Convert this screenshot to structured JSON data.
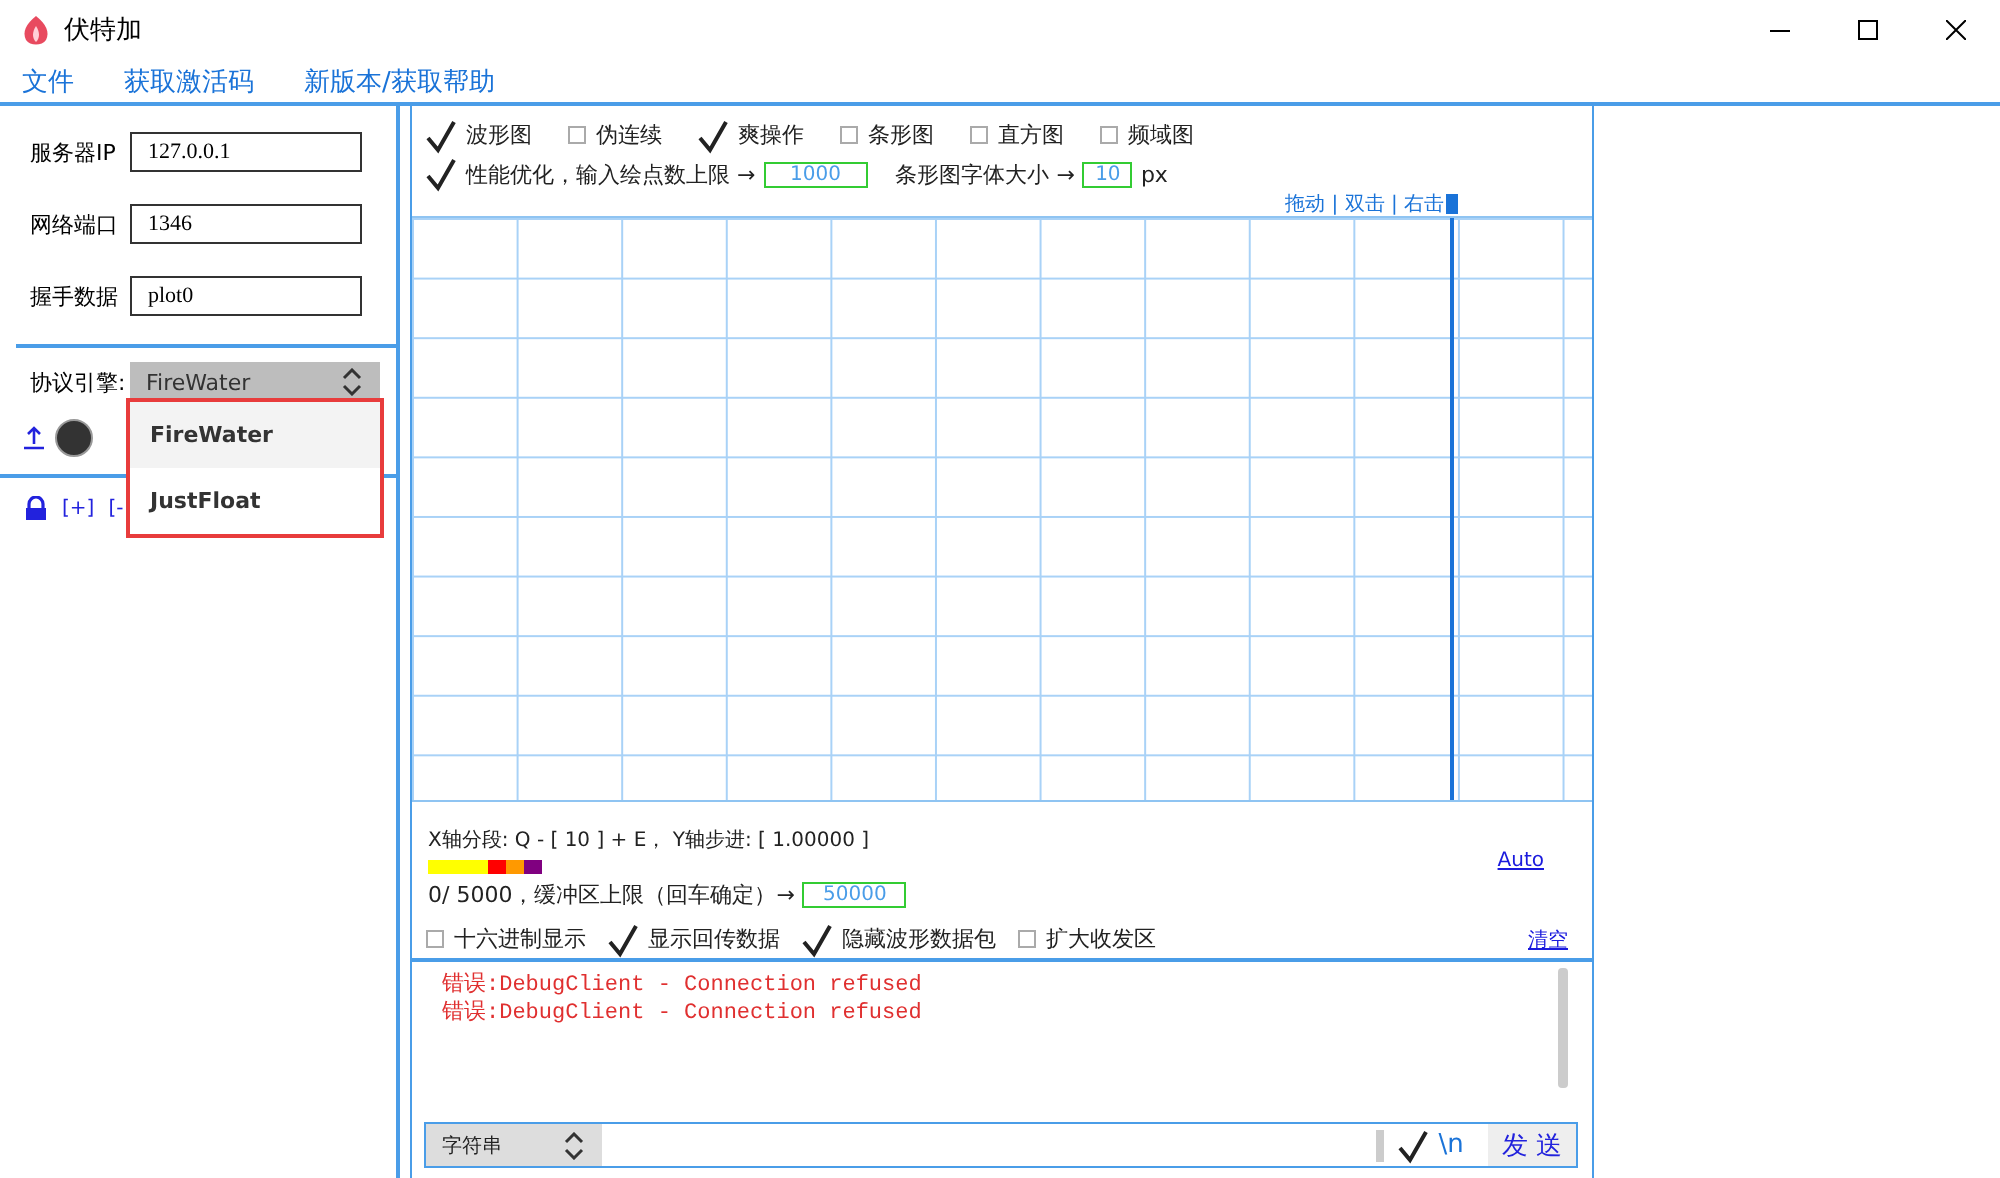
{
  "window": {
    "title": "伏特加"
  },
  "menu": [
    {
      "label": "文件"
    },
    {
      "label": "获取激活码"
    },
    {
      "label": "新版本/获取帮助"
    }
  ],
  "connection": {
    "fields": [
      {
        "label": "服务器IP",
        "value": "127.0.0.1"
      },
      {
        "label": "网络端口",
        "value": "1346"
      },
      {
        "label": "握手数据",
        "value": "plot0"
      }
    ],
    "protocol": {
      "label": "协议引擎:",
      "value": "FireWater",
      "options": [
        {
          "label": "FireWater",
          "selected": true
        },
        {
          "label": "JustFloat",
          "selected": false
        }
      ]
    },
    "toolbar": [
      "[+]",
      "[-"
    ]
  },
  "plot": {
    "options": [
      {
        "label": "波形图",
        "checked": true
      },
      {
        "label": "伪连续",
        "checked": false
      },
      {
        "label": "爽操作",
        "checked": true
      },
      {
        "label": "条形图",
        "checked": false
      },
      {
        "label": "直方图",
        "checked": false
      },
      {
        "label": "频域图",
        "checked": false
      }
    ],
    "perf": {
      "label": "性能优化，输入绘点数上限 →",
      "checked": true,
      "value": "1000"
    },
    "bar_font": {
      "label": "条形图字体大小 →",
      "value": "10",
      "unit": "px"
    },
    "hint": "拖动 | 双击 | 右击",
    "axis_info": "X轴分段: Q - [ 10 ] + E， Y轴步进: [ 1.00000 ]",
    "color_strip": [
      {
        "color": "#ffff00"
      },
      {
        "color": "#ff0000"
      },
      {
        "color": "#ff9900"
      },
      {
        "color": "#800080"
      }
    ],
    "buffer": {
      "label": "0/ 5000，缓冲区上限（回车确定）→",
      "value": "50000"
    },
    "auto_link": "Auto"
  },
  "console": {
    "options": [
      {
        "label": "十六进制显示",
        "checked": false
      },
      {
        "label": "显示回传数据",
        "checked": true
      },
      {
        "label": "隐藏波形数据包",
        "checked": true
      },
      {
        "label": "扩大收发区",
        "checked": false
      }
    ],
    "clear": "清空",
    "lines": [
      "错误:DebugClient - Connection refused",
      "错误:DebugClient - Connection refused"
    ]
  },
  "send": {
    "mode": "字符串",
    "newline": {
      "label": "\\n",
      "checked": true
    },
    "button": "发 送"
  }
}
